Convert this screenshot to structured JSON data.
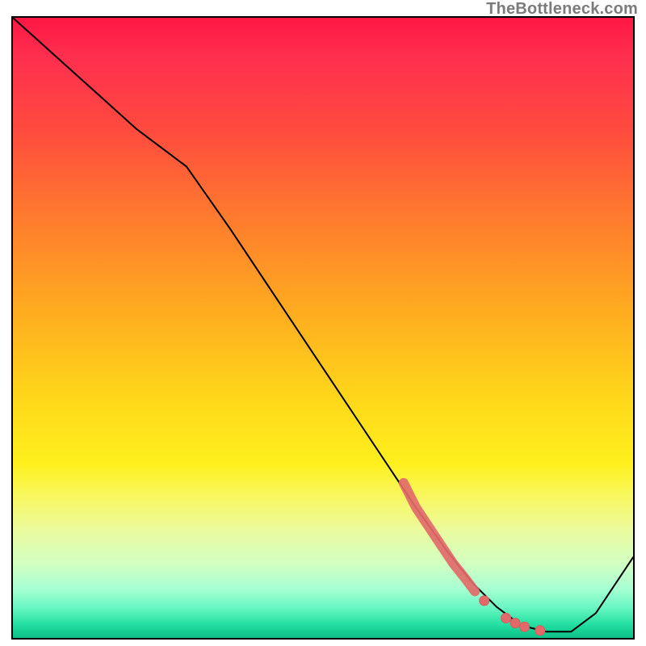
{
  "watermark": "TheBottleneck.com",
  "colors": {
    "curve_stroke": "#000000",
    "marker_fill": "#e26a6a",
    "marker_stroke": "#d85a5a",
    "gradient_top": "#ff1744",
    "gradient_bottom": "#0fbf87"
  },
  "chart_data": {
    "type": "line",
    "title": "",
    "xlabel": "",
    "ylabel": "",
    "xlim": [
      0,
      100
    ],
    "ylim": [
      0,
      100
    ],
    "grid": false,
    "legend": false,
    "curve": {
      "x": [
        0,
        10,
        20,
        28,
        35,
        45,
        55,
        65,
        70,
        74,
        78,
        82,
        86,
        90,
        94,
        100
      ],
      "y": [
        100,
        91,
        82,
        76,
        66,
        51,
        36,
        21,
        14,
        9,
        5,
        2,
        1,
        1,
        4,
        13
      ]
    },
    "series": [
      {
        "name": "highlighted-segment",
        "style": "thick-red-overlay",
        "x": [
          63,
          65,
          67,
          69,
          71,
          73,
          74.5
        ],
        "y": [
          25,
          21,
          18,
          15,
          12,
          9.5,
          7.5
        ]
      }
    ],
    "markers": [
      {
        "x": 76,
        "y": 6.0
      },
      {
        "x": 79.5,
        "y": 3.2
      },
      {
        "x": 81,
        "y": 2.4
      },
      {
        "x": 82.5,
        "y": 1.8
      },
      {
        "x": 85,
        "y": 1.2
      }
    ]
  }
}
